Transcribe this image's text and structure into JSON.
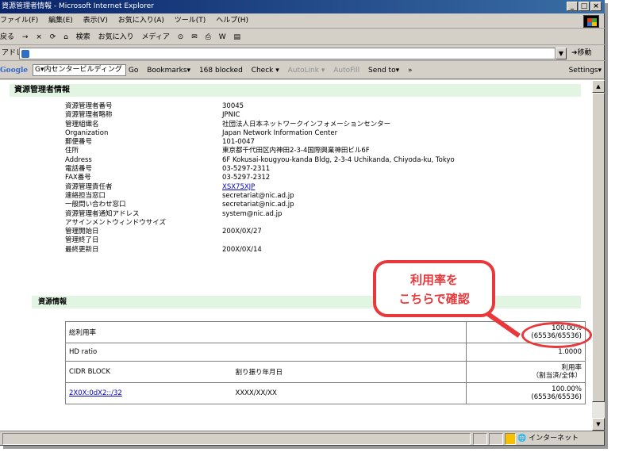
{
  "window": {
    "title": "資源管理者情報 - Microsoft Internet Explorer"
  },
  "menubar": [
    "ファイル(F)",
    "編集(E)",
    "表示(V)",
    "お気に入り(A)",
    "ツール(T)",
    "ヘルプ(H)"
  ],
  "toolbar": [
    "戻る",
    "→",
    "×",
    "⟳",
    "⌂",
    "検索",
    "お気に入り",
    "メディア",
    "⊙",
    "✉",
    "⎙",
    "W",
    "▤"
  ],
  "addressbar": {
    "label": "アドレス(D)",
    "go_label": "移動"
  },
  "googlebar": {
    "brand": "Google",
    "combo_value": "G▾内センタービルディング",
    "items": [
      "Go",
      "Bookmarks▾",
      "168 blocked",
      "Check ▾",
      "AutoLink ▾",
      "AutoFill",
      "Send to▾",
      "»",
      "Settings▾"
    ]
  },
  "page": {
    "title": "資源管理者情報",
    "fields": [
      {
        "label": "資源管理者番号",
        "value": "30045"
      },
      {
        "label": "資源管理者略称",
        "value": "JPNIC"
      },
      {
        "label": "管理組織名",
        "value": "社団法人日本ネットワークインフォメーションセンター"
      },
      {
        "label": "Organization",
        "value": "Japan Network Information Center"
      },
      {
        "label": "郵便番号",
        "value": "101-0047"
      },
      {
        "label": "住所",
        "value": "東京都千代田区内神田2-3-4国際興業神田ビル6F"
      },
      {
        "label": "Address",
        "value": "6F Kokusai-kougyou-kanda Bldg, 2-3-4 Uchikanda, Chiyoda-ku, Tokyo"
      },
      {
        "label": "電話番号",
        "value": "03-5297-2311"
      },
      {
        "label": "FAX番号",
        "value": "03-5297-2312"
      },
      {
        "label": "資源管理責任者",
        "value": "XSX75XJP",
        "link": true
      },
      {
        "label": "連絡担当窓口",
        "value": "secretariat@nic.ad.jp"
      },
      {
        "label": "一般問い合わせ窓口",
        "value": "secretariat@nic.ad.jp"
      },
      {
        "label": "資源管理者通知アドレス",
        "value": "system@nic.ad.jp"
      },
      {
        "label": "アサインメントウィンドウサイズ",
        "value": ""
      },
      {
        "label": "管理開始日",
        "value": "200X/0X/27"
      },
      {
        "label": "管理終了日",
        "value": ""
      },
      {
        "label": "最終更新日",
        "value": "200X/0X/14"
      }
    ],
    "resource_section_title": "資源情報",
    "total_usage": {
      "label": "総利用率",
      "value": "100.00%",
      "detail": "(65536/65536)"
    },
    "hd_ratio": {
      "label": "HD ratio",
      "value": "1.0000"
    },
    "cidr_header": {
      "col1": "CIDR BLOCK",
      "col2": "割り振り年月日",
      "col3_line1": "利用率",
      "col3_line2": "（割当済/全体）"
    },
    "cidr_row": {
      "block": "2X0X:0dX2::/32",
      "date": "XXXX/XX/XX",
      "rate": "100.00%",
      "detail": "(65536/65536)"
    }
  },
  "callout": {
    "line1": "利用率を",
    "line2": "こちらで確認",
    "color": "#e8383c"
  },
  "statusbar": {
    "zone": "インターネット"
  }
}
